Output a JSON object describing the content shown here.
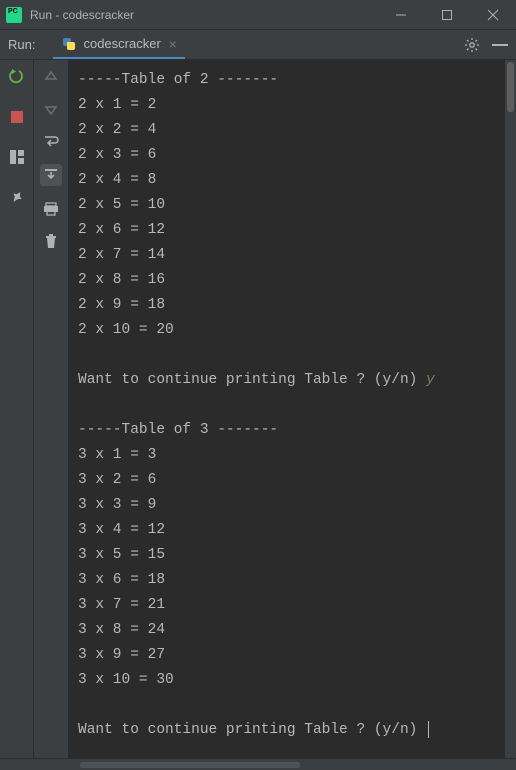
{
  "window": {
    "title": "Run - codescracker"
  },
  "tab": {
    "run_label": "Run:",
    "name": "codescracker"
  },
  "console": {
    "header1": "-----Table of 2 -------",
    "t2": [
      "2 x 1 = 2",
      "2 x 2 = 4",
      "2 x 3 = 6",
      "2 x 4 = 8",
      "2 x 5 = 10",
      "2 x 6 = 12",
      "2 x 7 = 14",
      "2 x 8 = 16",
      "2 x 9 = 18",
      "2 x 10 = 20"
    ],
    "prompt1": "Want to continue printing Table ? (y/n) ",
    "answer1": "y",
    "header2": "-----Table of 3 -------",
    "t3": [
      "3 x 1 = 3",
      "3 x 2 = 6",
      "3 x 3 = 9",
      "3 x 4 = 12",
      "3 x 5 = 15",
      "3 x 6 = 18",
      "3 x 7 = 21",
      "3 x 8 = 24",
      "3 x 9 = 27",
      "3 x 10 = 30"
    ],
    "prompt2": "Want to continue printing Table ? (y/n) "
  }
}
